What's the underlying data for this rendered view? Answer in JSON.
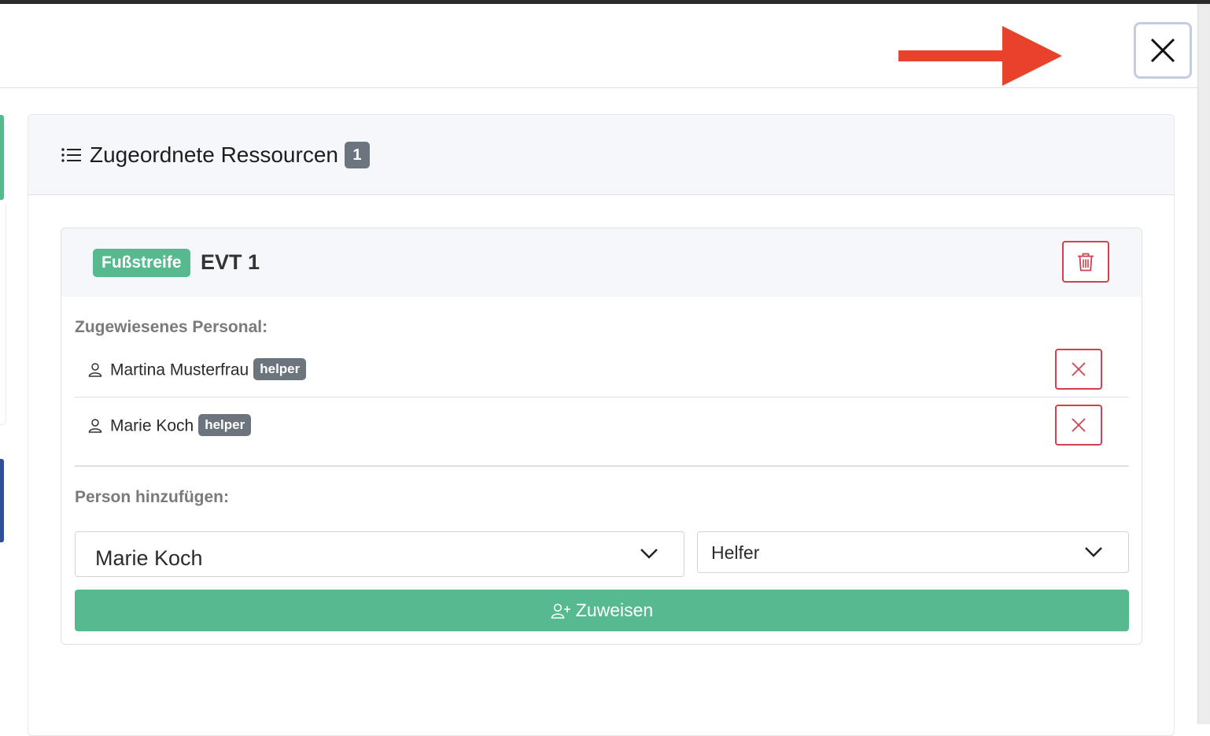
{
  "card": {
    "title": "Zugeordnete Ressourcen",
    "count": "1"
  },
  "resource": {
    "type_badge": "Fußstreife",
    "name": "EVT 1",
    "assigned_label": "Zugewiesenes Personal:",
    "personnel": [
      {
        "name": "Martina Musterfrau",
        "role": "helper"
      },
      {
        "name": "Marie Koch",
        "role": "helper"
      }
    ],
    "add_label": "Person hinzufügen:",
    "person_select": {
      "value": "Marie Koch"
    },
    "role_select": {
      "value": "Helfer"
    },
    "assign_label": "Zuweisen"
  },
  "icons": {
    "close": "close-icon",
    "arrow": "arrow-right-icon",
    "list": "list-icon",
    "trash": "trash-icon",
    "person": "person-icon",
    "remove": "x-icon",
    "chevron": "chevron-down-icon",
    "person_add": "person-add-icon"
  },
  "colors": {
    "accent_green": "#56ba8e",
    "danger_red": "#d0414f",
    "badge_gray": "#6c757d",
    "arrow_red": "#e8412c"
  }
}
